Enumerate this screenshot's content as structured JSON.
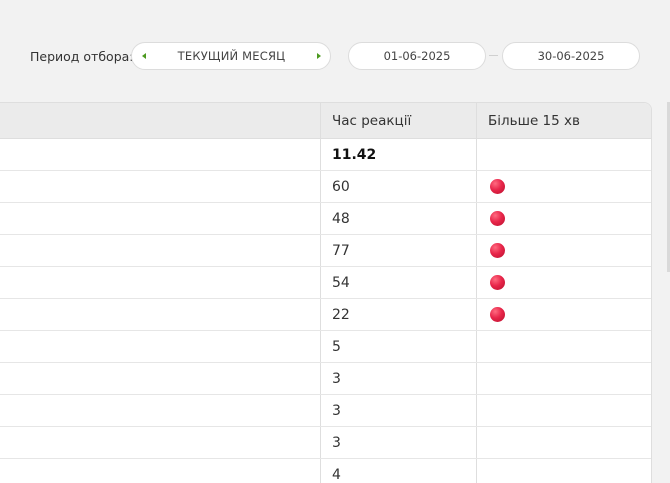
{
  "filter": {
    "label": "Период отбора:",
    "period_value": "ТЕКУЩИЙ МЕСЯЦ",
    "date_from": "01-06-2025",
    "date_to": "30-06-2025"
  },
  "table": {
    "columns": [
      "",
      "Час реакції",
      "Більше 15 хв"
    ],
    "summary_value": "11.42",
    "rows": [
      {
        "value": "60",
        "flag": true
      },
      {
        "value": "48",
        "flag": true
      },
      {
        "value": "77",
        "flag": true
      },
      {
        "value": "54",
        "flag": true
      },
      {
        "value": "22",
        "flag": true
      },
      {
        "value": "5",
        "flag": false
      },
      {
        "value": "3",
        "flag": false
      },
      {
        "value": "3",
        "flag": false
      },
      {
        "value": "3",
        "flag": false
      },
      {
        "value": "4",
        "flag": false
      }
    ],
    "colors": {
      "flag": "#e8264a",
      "accent": "#4c9a1f"
    }
  }
}
